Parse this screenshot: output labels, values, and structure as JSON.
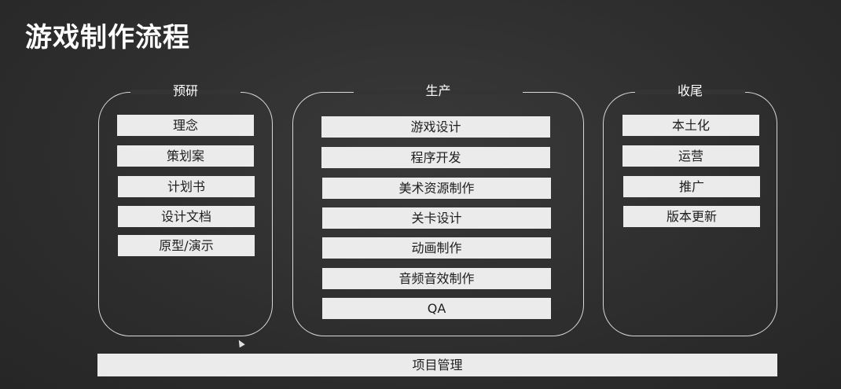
{
  "title": "游戏制作流程",
  "groups": [
    {
      "name": "预研",
      "items": [
        "理念",
        "策划案",
        "计划书",
        "设计文档",
        "原型/演示"
      ]
    },
    {
      "name": "生产",
      "items": [
        "游戏设计",
        "程序开发",
        "美术资源制作",
        "关卡设计",
        "动画制作",
        "音频音效制作",
        "QA"
      ]
    },
    {
      "name": "收尾",
      "items": [
        "本土化",
        "运营",
        "推广",
        "版本更新"
      ]
    }
  ],
  "footer_bar": "项目管理"
}
